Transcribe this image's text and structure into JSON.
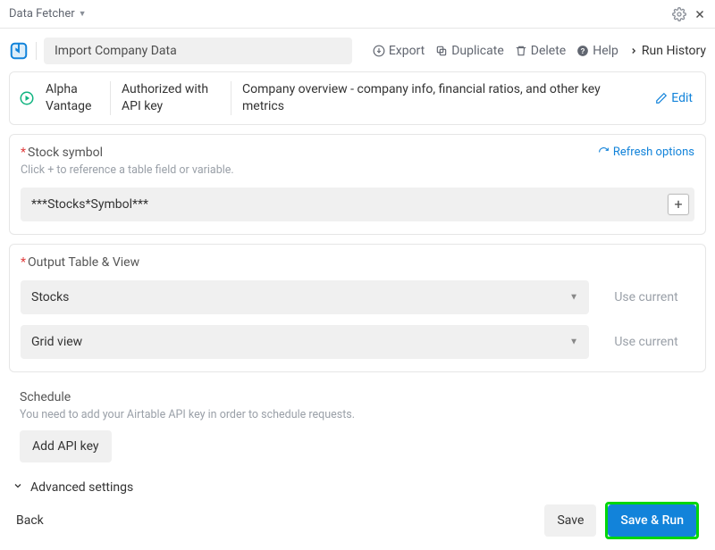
{
  "titlebar": {
    "app_name": "Data Fetcher"
  },
  "action": {
    "name": "Import Company Data",
    "links": {
      "export": "Export",
      "duplicate": "Duplicate",
      "delete": "Delete",
      "help": "Help",
      "run_history": "Run History"
    }
  },
  "api": {
    "provider": "Alpha Vantage",
    "auth": "Authorized with API key",
    "description": "Company overview - company info, financial ratios, and other key metrics",
    "edit": "Edit"
  },
  "stock": {
    "label": "Stock symbol",
    "hint": "Click + to reference a table field or variable.",
    "value": "***Stocks*Symbol***",
    "refresh": "Refresh options"
  },
  "output": {
    "label": "Output Table & View",
    "table": "Stocks",
    "view": "Grid view",
    "use_current": "Use current"
  },
  "schedule": {
    "label": "Schedule",
    "hint": "You need to add your Airtable API key in order to schedule requests.",
    "add_key": "Add API key"
  },
  "advanced": {
    "label": "Advanced settings"
  },
  "footer": {
    "back": "Back",
    "save": "Save",
    "save_run": "Save & Run"
  }
}
